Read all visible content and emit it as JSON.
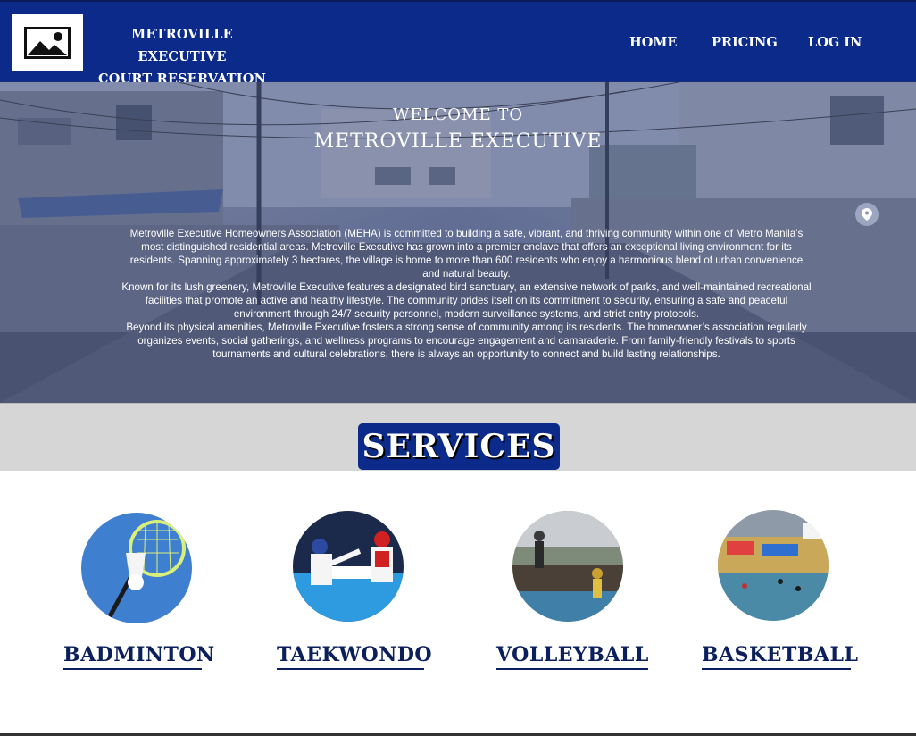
{
  "header": {
    "logo_icon": "image-placeholder-icon",
    "brand_line1": "METROVILLE EXECUTIVE",
    "brand_line2": "COURT RESERVATION",
    "nav": [
      {
        "label": "HOME"
      },
      {
        "label": "PRICING"
      },
      {
        "label": "LOG IN"
      }
    ],
    "bg_color": "#0b2a8a"
  },
  "hero": {
    "welcome": "WELCOME TO",
    "title": "METROVILLE EXECUTIVE",
    "paragraphs": [
      "Metroville Executive Homeowners Association (MEHA) is committed to building a safe, vibrant, and thriving community within one of Metro Manila’s most distinguished residential areas. Metroville Executive has grown into a premier enclave that offers an exceptional living environment for its residents. Spanning approximately 3 hectares, the village is home to more than 600 residents who enjoy a harmonious blend of urban convenience and natural beauty.",
      "Known for its lush greenery, Metroville Executive features a designated bird sanctuary, an extensive network of parks, and well-maintained recreational facilities that promote an active and healthy lifestyle. The community prides itself on its commitment to security, ensuring a safe and peaceful environment through 24/7 security personnel, modern surveillance systems, and strict entry protocols.",
      "Beyond its physical amenities, Metroville Executive fosters a strong sense of community among its residents. The homeowner’s association regularly organizes events, social gatherings, and wellness programs to encourage engagement and camaraderie. From family-friendly festivals to sports tournaments and cultural celebrations, there is always an opportunity to connect and build lasting relationships."
    ],
    "pin_icon": "map-pin-icon"
  },
  "services": {
    "title": "SERVICES",
    "items": [
      {
        "label": "BADMINTON",
        "icon": "badminton-image"
      },
      {
        "label": "TAEKWONDO",
        "icon": "taekwondo-image"
      },
      {
        "label": "VOLLEYBALL",
        "icon": "volleyball-image"
      },
      {
        "label": "BASKETBALL",
        "icon": "basketball-image"
      }
    ]
  }
}
